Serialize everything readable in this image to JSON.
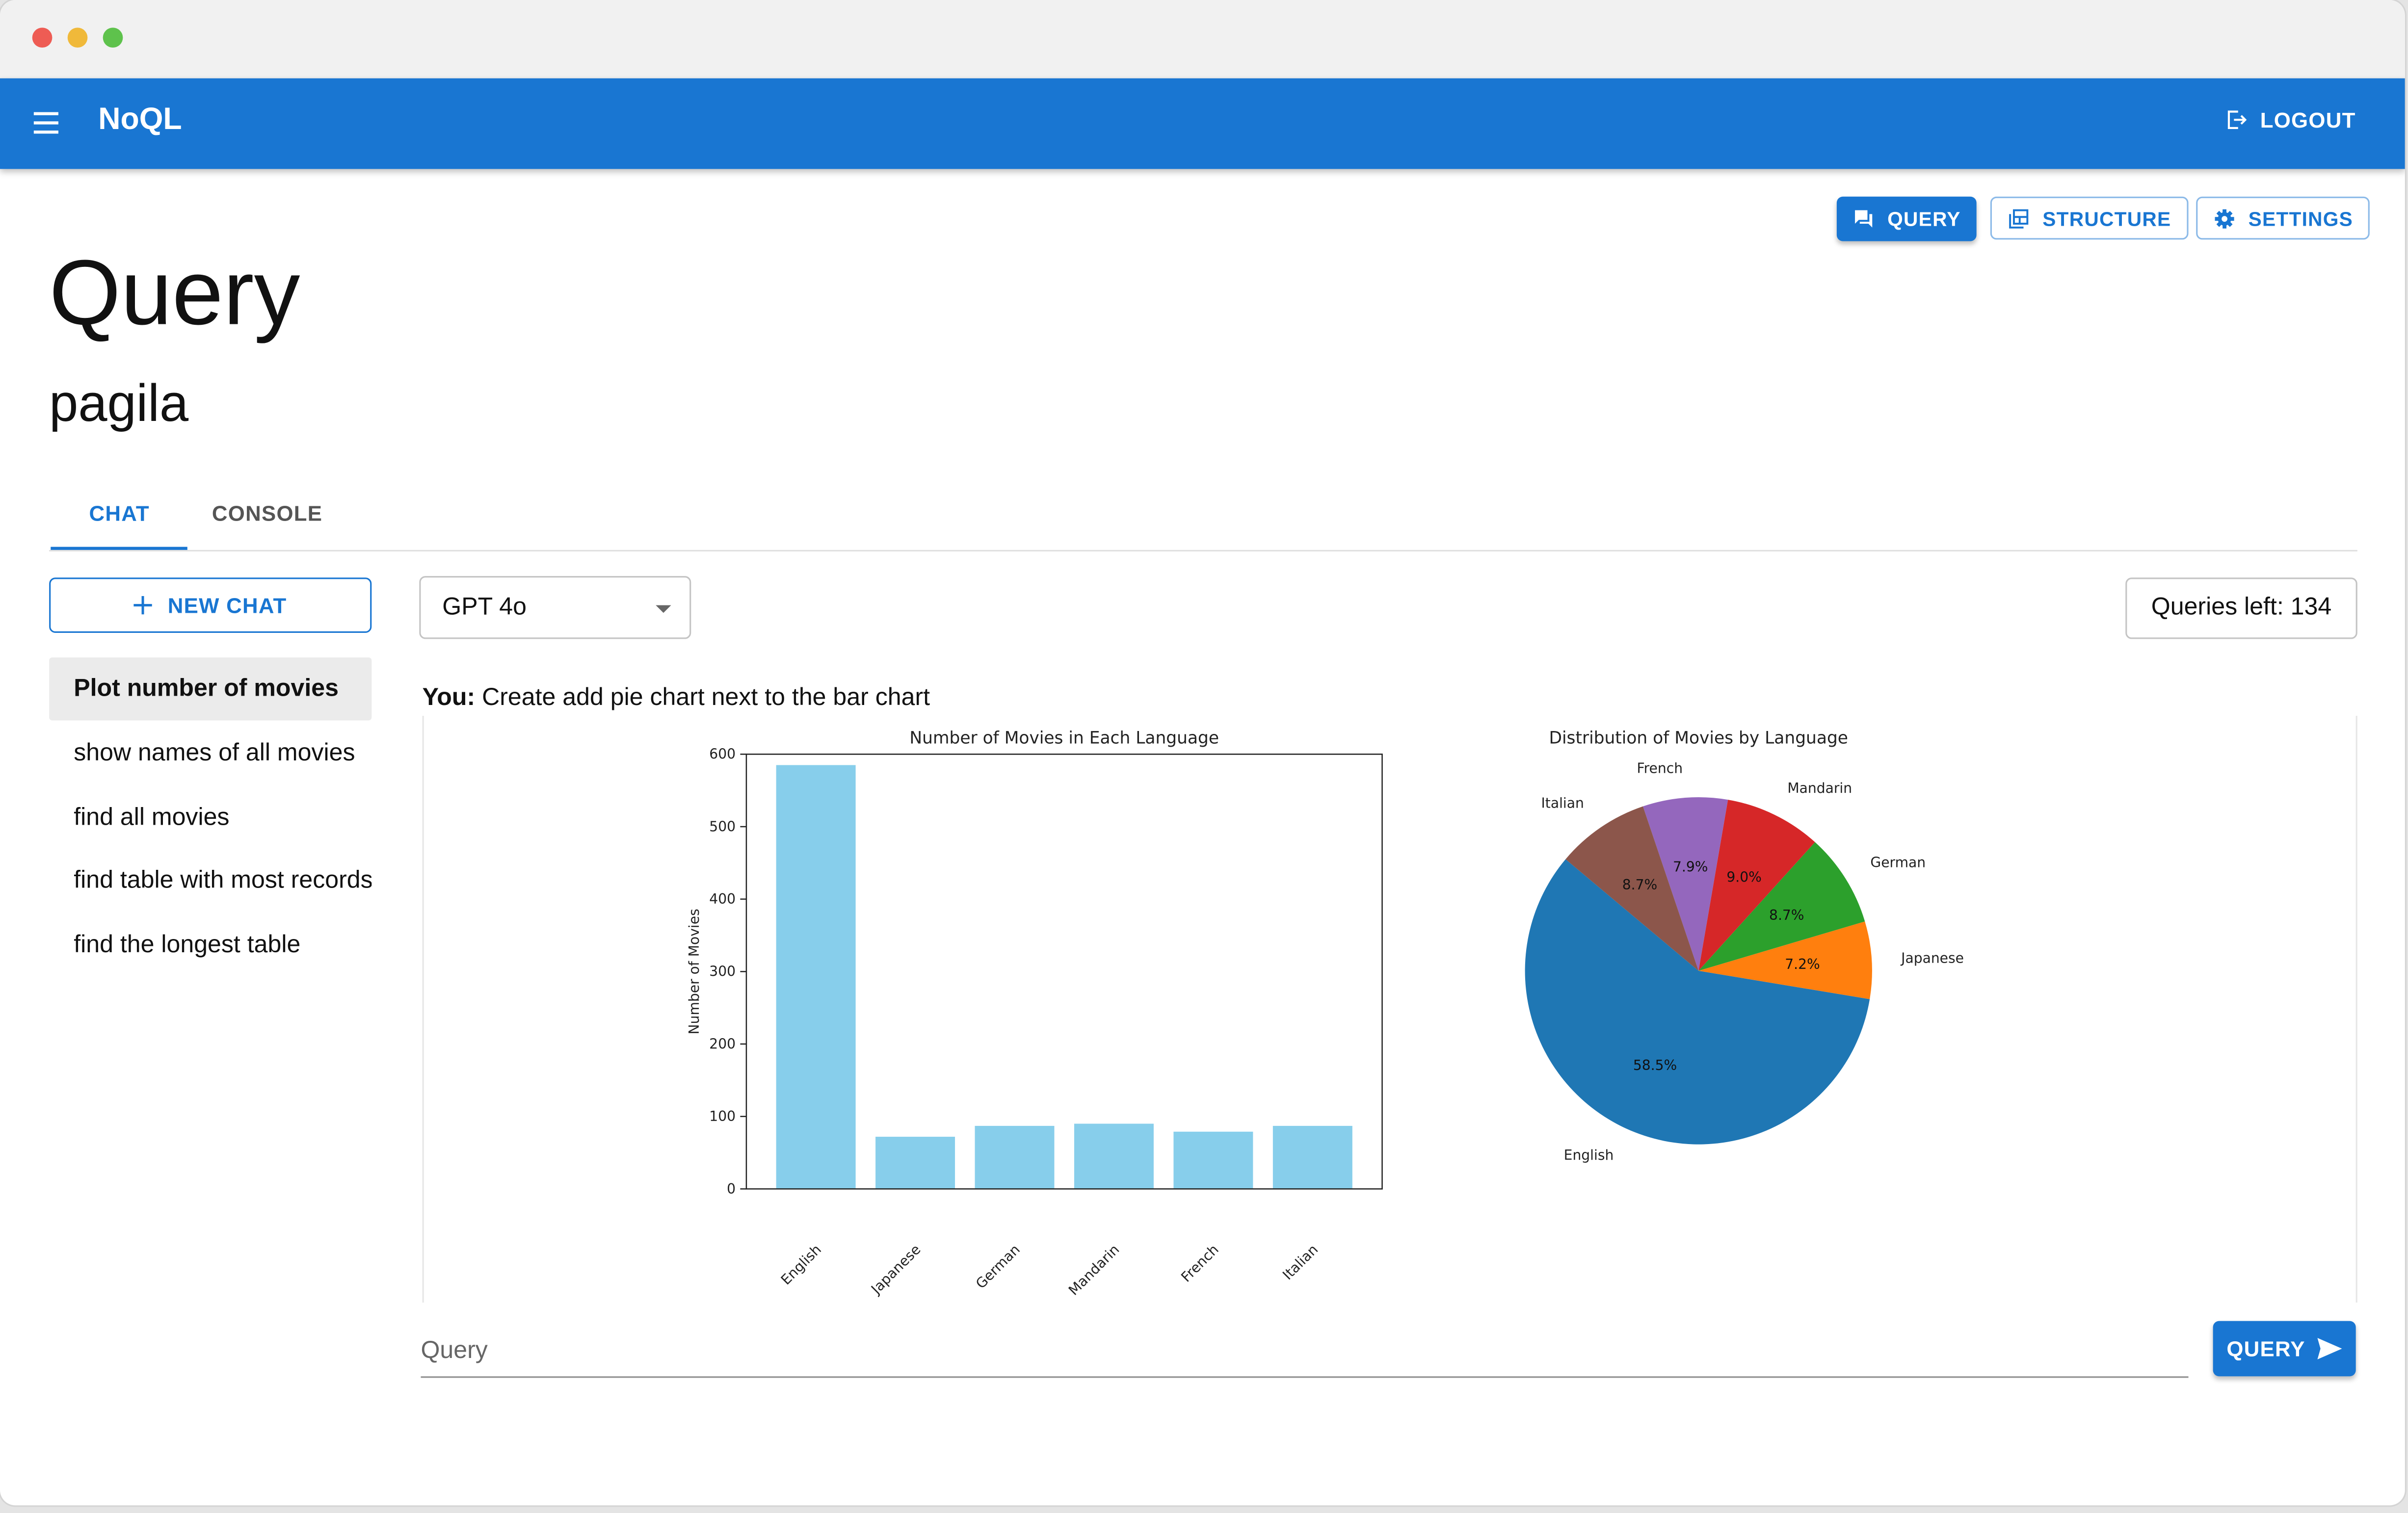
{
  "window": {
    "traffic_lights": [
      "#ee5c54",
      "#f0b93a",
      "#5ec24c"
    ]
  },
  "appbar": {
    "title": "NoQL",
    "logout_label": "LOGOUT",
    "color": "#1976d2"
  },
  "nav_buttons": {
    "query": "QUERY",
    "structure": "STRUCTURE",
    "settings": "SETTINGS"
  },
  "page": {
    "title": "Query",
    "database": "pagila"
  },
  "tabs": [
    {
      "label": "CHAT",
      "active": true
    },
    {
      "label": "CONSOLE",
      "active": false
    }
  ],
  "sidebar": {
    "new_chat_label": "NEW CHAT",
    "chats": [
      {
        "label": "Plot number of movies",
        "active": true
      },
      {
        "label": "show names of all movies",
        "active": false
      },
      {
        "label": "find all movies",
        "active": false
      },
      {
        "label": "find table with most records",
        "active": false
      },
      {
        "label": "find the longest table",
        "active": false
      }
    ]
  },
  "model_select": {
    "value": "GPT 4o"
  },
  "queries_left": "Queries left: 134",
  "message": {
    "author": "You:",
    "text": "Create add pie chart next to the bar chart"
  },
  "query_input": {
    "placeholder": "Query",
    "value": ""
  },
  "query_submit_label": "QUERY",
  "chart_data": [
    {
      "type": "bar",
      "title": "Number of Movies in Each Language",
      "xlabel": "",
      "ylabel": "Number of Movies",
      "categories": [
        "English",
        "Japanese",
        "German",
        "Mandarin",
        "French",
        "Italian"
      ],
      "values": [
        585,
        72,
        87,
        90,
        79,
        87
      ],
      "ylim": [
        0,
        600
      ],
      "yticks": [
        0,
        100,
        200,
        300,
        400,
        500,
        600
      ],
      "color": "#87ceeb"
    },
    {
      "type": "pie",
      "title": "Distribution of Movies by Language",
      "labels": [
        "English",
        "Japanese",
        "German",
        "Mandarin",
        "French",
        "Italian"
      ],
      "values": [
        58.5,
        7.2,
        8.7,
        9.0,
        7.9,
        8.7
      ],
      "value_labels": [
        "58.5%",
        "7.2%",
        "8.7%",
        "9.0%",
        "7.9%",
        "8.7%"
      ],
      "colors": [
        "#1f77b4",
        "#ff7f0e",
        "#2ca02c",
        "#d62728",
        "#9467bd",
        "#8c564b"
      ]
    }
  ]
}
